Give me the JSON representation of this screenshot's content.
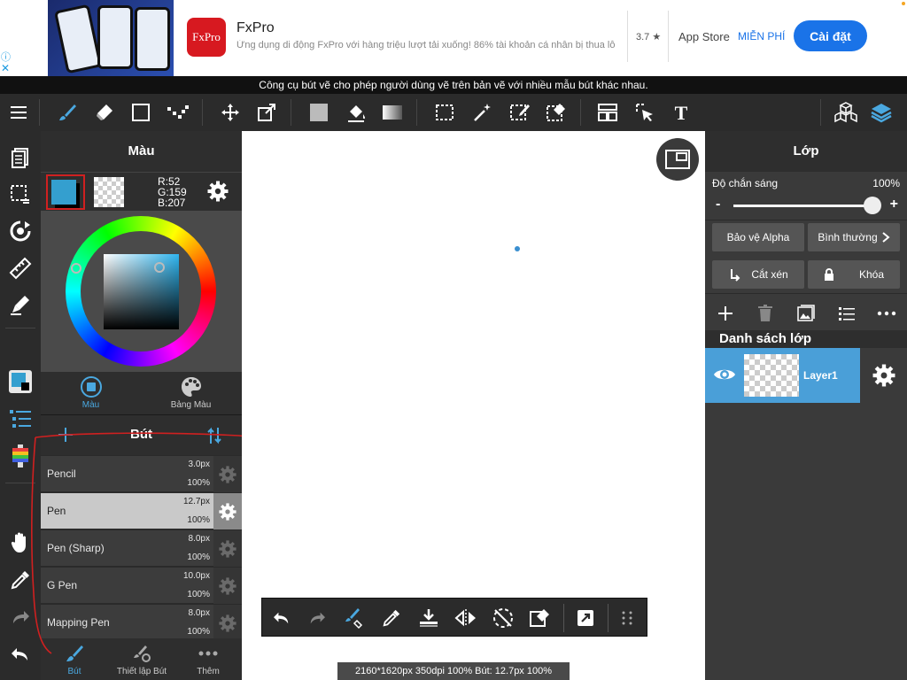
{
  "ad": {
    "app_name": "FxPro",
    "logo_text": "FxPro",
    "description": "Ứng dụng di động FxPro với hàng triệu lượt tải xuống! 86% tài khoản cá nhân bị thua lỗ",
    "rating": "3.7 ★",
    "store": "App Store",
    "price": "MIỄN PHÍ",
    "install_label": "Cài đặt",
    "info_glyph": "ⓘ",
    "close_glyph": "✕"
  },
  "tooltip": "Công cụ bút vẽ cho phép người dùng vẽ trên bản vẽ với nhiều mẫu bút khác nhau.",
  "toolbar": {
    "icons": [
      "menu-icon",
      "brush-icon",
      "eraser-icon",
      "rectangle-icon",
      "dot-brush-icon",
      "move-icon",
      "transform-icon",
      "fill-color-icon",
      "bucket-icon",
      "gradient-icon",
      "select-rect-icon",
      "magic-wand-icon",
      "select-pen-icon",
      "select-eraser-icon",
      "layout-icon",
      "select-move-icon",
      "text-icon",
      "material-icon",
      "layers-icon"
    ]
  },
  "color_panel": {
    "title": "Màu",
    "main_color": "#349fcf",
    "r": "R:52",
    "g": "G:159",
    "b": "B:207",
    "tabs": [
      "Màu",
      "Bảng Màu"
    ]
  },
  "brush_panel": {
    "title": "Bút",
    "brushes": [
      {
        "name": "Pencil",
        "size": "3.0px",
        "opacity": "100%",
        "active": false
      },
      {
        "name": "Pen",
        "size": "12.7px",
        "opacity": "100%",
        "active": true
      },
      {
        "name": "Pen (Sharp)",
        "size": "8.0px",
        "opacity": "100%",
        "active": false
      },
      {
        "name": "G Pen",
        "size": "10.0px",
        "opacity": "100%",
        "active": false
      },
      {
        "name": "Mapping Pen",
        "size": "8.0px",
        "opacity": "100%",
        "active": false
      }
    ],
    "tabs": [
      "Bút",
      "Thiết lập Bút",
      "Thêm"
    ]
  },
  "canvas": {
    "status": "2160*1620px 350dpi 100% Bút: 12.7px 100%"
  },
  "layer_panel": {
    "title": "Lớp",
    "opacity_label": "Độ chắn sáng",
    "opacity_value": "100%",
    "minus": "-",
    "plus": "+",
    "alpha_protect": "Bảo vệ Alpha",
    "blend_mode": "Bình thường",
    "clipping": "Cắt xén",
    "lock": "Khóa",
    "list_title": "Danh sách lớp",
    "layers": [
      {
        "name": "Layer1",
        "visible": true,
        "selected": true
      }
    ]
  },
  "colors": {
    "accent": "#4a9fd8",
    "toolbar_bg": "#2b2b2b",
    "install_blue": "#1a73e8",
    "annotation_red": "#d02020"
  }
}
